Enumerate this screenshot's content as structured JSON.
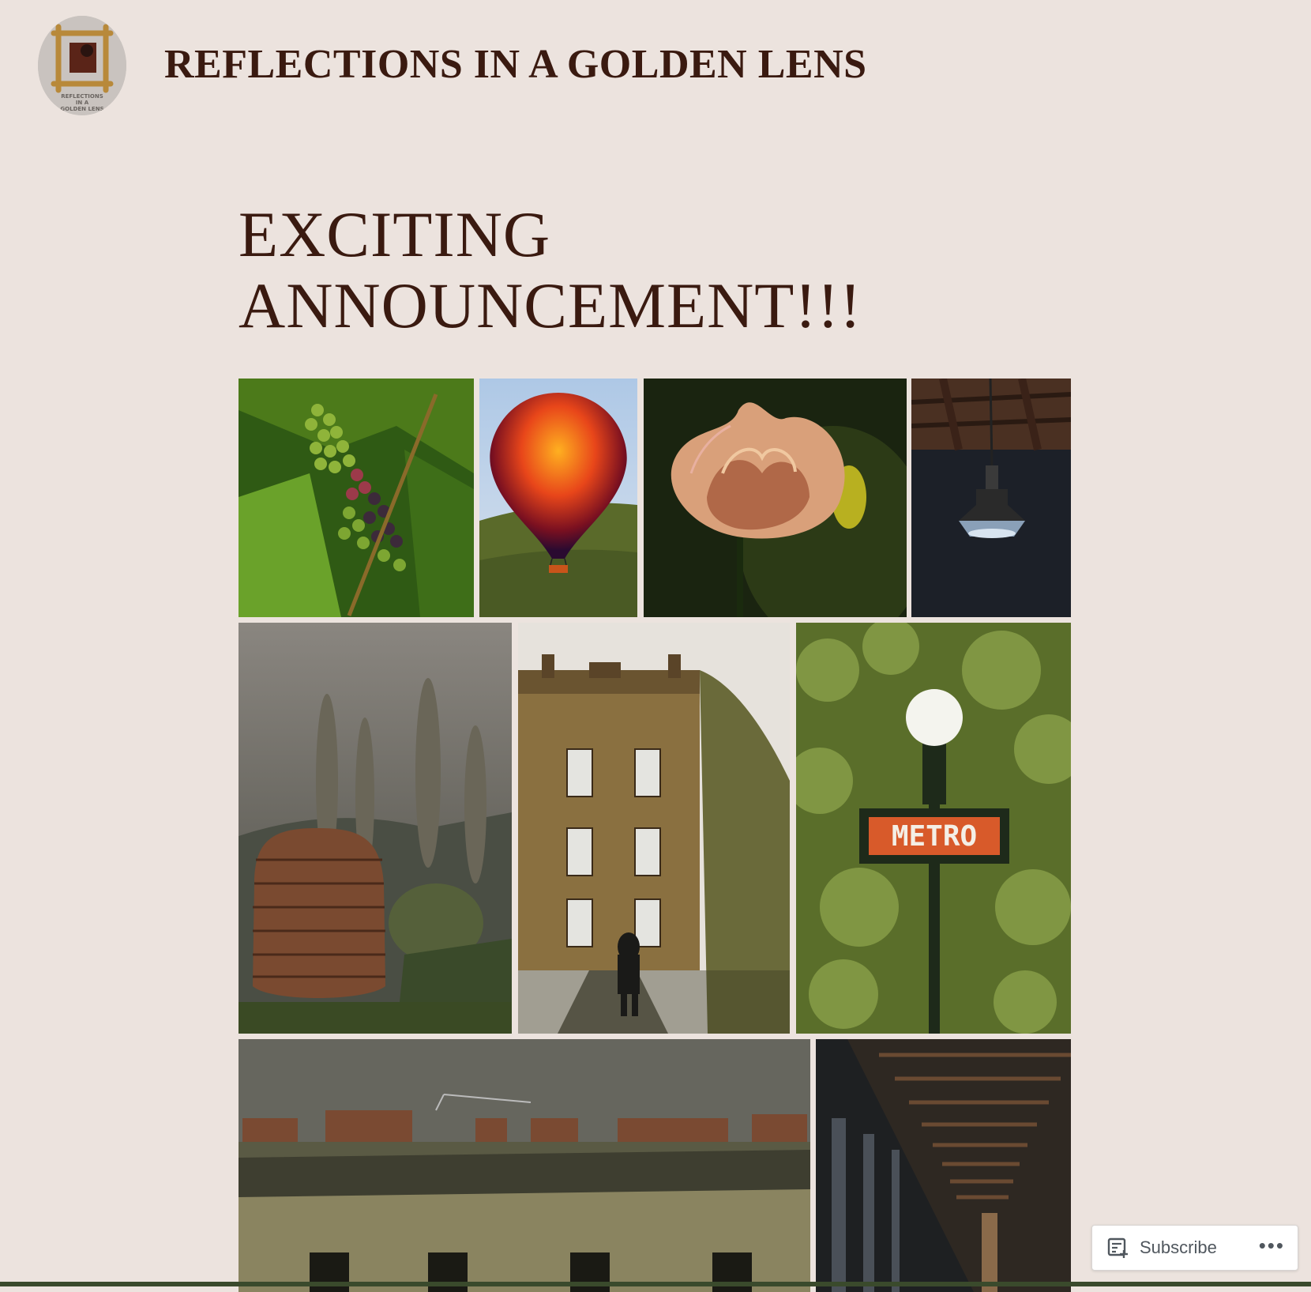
{
  "header": {
    "logo_alt": "site-logo",
    "logo_text": [
      "REFLECTIONS",
      "IN A",
      "GOLDEN LENS"
    ],
    "site_title": "REFLECTIONS IN A GOLDEN LENS"
  },
  "post": {
    "title": "EXCITING ANNOUNCEMENT!!!"
  },
  "gallery": {
    "tiles": [
      {
        "subject": "grapes-on-vine"
      },
      {
        "subject": "hot-air-balloon"
      },
      {
        "subject": "tulip-flower"
      },
      {
        "subject": "hanging-lamp"
      },
      {
        "subject": "stacked-wood-sculpture"
      },
      {
        "subject": "stately-house-walker"
      },
      {
        "subject": "metro-sign-lamp",
        "sign_text": "METRO"
      },
      {
        "subject": "rooftops-chimneys"
      },
      {
        "subject": "arcade-corridor"
      }
    ]
  },
  "subscribe_bar": {
    "subscribe_label": "Subscribe",
    "more_label": "•••"
  },
  "colors": {
    "background": "#ece3de",
    "title": "#3a1a10"
  }
}
